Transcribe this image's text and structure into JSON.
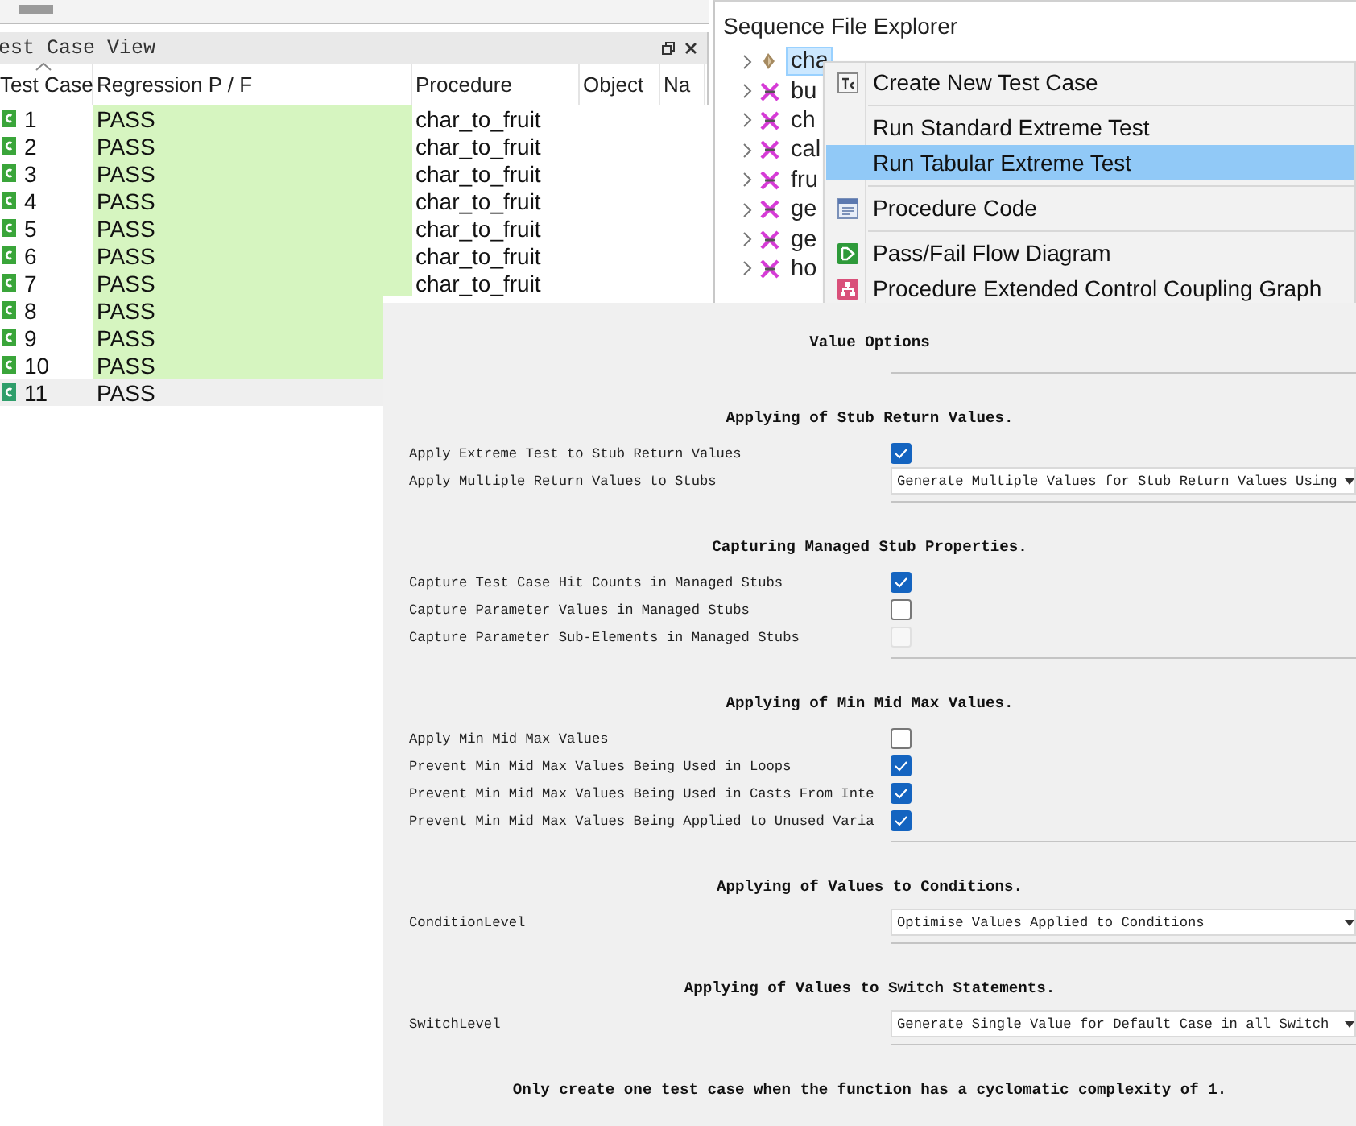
{
  "test_case_view": {
    "title": "est Case View",
    "columns": [
      "Test Case",
      "Regression P / F",
      "Procedure",
      "Object",
      "Na"
    ],
    "rows": [
      {
        "test_case": "1",
        "regression": "PASS",
        "procedure": "char_to_fruit",
        "selected": false
      },
      {
        "test_case": "2",
        "regression": "PASS",
        "procedure": "char_to_fruit",
        "selected": false
      },
      {
        "test_case": "3",
        "regression": "PASS",
        "procedure": "char_to_fruit",
        "selected": false
      },
      {
        "test_case": "4",
        "regression": "PASS",
        "procedure": "char_to_fruit",
        "selected": false
      },
      {
        "test_case": "5",
        "regression": "PASS",
        "procedure": "char_to_fruit",
        "selected": false
      },
      {
        "test_case": "6",
        "regression": "PASS",
        "procedure": "char_to_fruit",
        "selected": false
      },
      {
        "test_case": "7",
        "regression": "PASS",
        "procedure": "char_to_fruit",
        "selected": false
      },
      {
        "test_case": "8",
        "regression": "PASS",
        "selected": false
      },
      {
        "test_case": "9",
        "regression": "PASS",
        "selected": false
      },
      {
        "test_case": "10",
        "regression": "PASS",
        "selected": false
      },
      {
        "test_case": "11",
        "regression": "PASS",
        "selected": true
      }
    ]
  },
  "sequence_file_explorer": {
    "title": "Sequence File Explorer",
    "items": [
      {
        "label": "cha",
        "kind": "file",
        "selected": true
      },
      {
        "label": "bu",
        "kind": "crossed",
        "selected": false
      },
      {
        "label": "ch",
        "kind": "crossed",
        "selected": false
      },
      {
        "label": "cal",
        "kind": "crossed",
        "selected": false
      },
      {
        "label": "fru",
        "kind": "crossed",
        "selected": false
      },
      {
        "label": "ge",
        "kind": "crossed",
        "selected": false
      },
      {
        "label": "ge",
        "kind": "crossed",
        "selected": false
      },
      {
        "label": "ho",
        "kind": "crossed",
        "selected": false
      }
    ]
  },
  "context_menu": {
    "items": [
      {
        "label": "Create New Test Case",
        "kind": "test-case",
        "separator_before": false,
        "selected": false
      },
      {
        "label": "Run Standard Extreme Test",
        "kind": "plain",
        "separator_before": true,
        "selected": false
      },
      {
        "label": "Run Tabular Extreme Test",
        "kind": "plain",
        "separator_before": false,
        "selected": true
      },
      {
        "label": "Procedure Code",
        "kind": "code",
        "separator_before": true,
        "selected": false
      },
      {
        "label": "Pass/Fail Flow Diagram",
        "kind": "flow",
        "separator_before": true,
        "selected": false
      },
      {
        "label": "Procedure Extended Control Coupling Graph",
        "kind": "graph",
        "separator_before": false,
        "selected": false
      }
    ]
  },
  "value_options": {
    "title": "Value Options",
    "sections": [
      {
        "heading": "Applying of Stub Return Values.",
        "rows": [
          {
            "label": "Apply Extreme Test to Stub Return Values",
            "kind": "checkbox",
            "checked": true,
            "disabled": false
          },
          {
            "label": "Apply Multiple Return Values to Stubs",
            "kind": "dropdown",
            "value": "Generate Multiple Values for Stub Return Values Using"
          }
        ]
      },
      {
        "heading": "Capturing Managed Stub Properties.",
        "rows": [
          {
            "label": "Capture Test Case Hit Counts in Managed Stubs",
            "kind": "checkbox",
            "checked": true,
            "disabled": false
          },
          {
            "label": "Capture Parameter Values in Managed Stubs",
            "kind": "checkbox",
            "checked": false,
            "disabled": false
          },
          {
            "label": "Capture Parameter Sub-Elements in Managed Stubs",
            "kind": "checkbox",
            "checked": false,
            "disabled": true
          }
        ]
      },
      {
        "heading": "Applying of Min Mid Max Values.",
        "rows": [
          {
            "label": "Apply Min Mid Max Values",
            "kind": "checkbox",
            "checked": false,
            "disabled": false
          },
          {
            "label": "Prevent Min Mid Max Values Being Used in Loops",
            "kind": "checkbox",
            "checked": true,
            "disabled": false
          },
          {
            "label": "Prevent Min Mid Max Values Being Used in Casts From Inte",
            "kind": "checkbox",
            "checked": true,
            "disabled": false
          },
          {
            "label": "Prevent Min Mid Max Values Being Applied to Unused Varia",
            "kind": "checkbox",
            "checked": true,
            "disabled": false
          }
        ]
      },
      {
        "heading": "Applying of Values to Conditions.",
        "rows": [
          {
            "label": "ConditionLevel",
            "kind": "dropdown",
            "value": "Optimise Values Applied to Conditions"
          }
        ]
      },
      {
        "heading": "Applying of Values to Switch Statements.",
        "rows": [
          {
            "label": "SwitchLevel",
            "kind": "dropdown",
            "value": "Generate Single Value for Default Case in all Switch"
          }
        ]
      }
    ],
    "note": "Only create one test case when the function has a cyclomatic complexity of 1."
  }
}
